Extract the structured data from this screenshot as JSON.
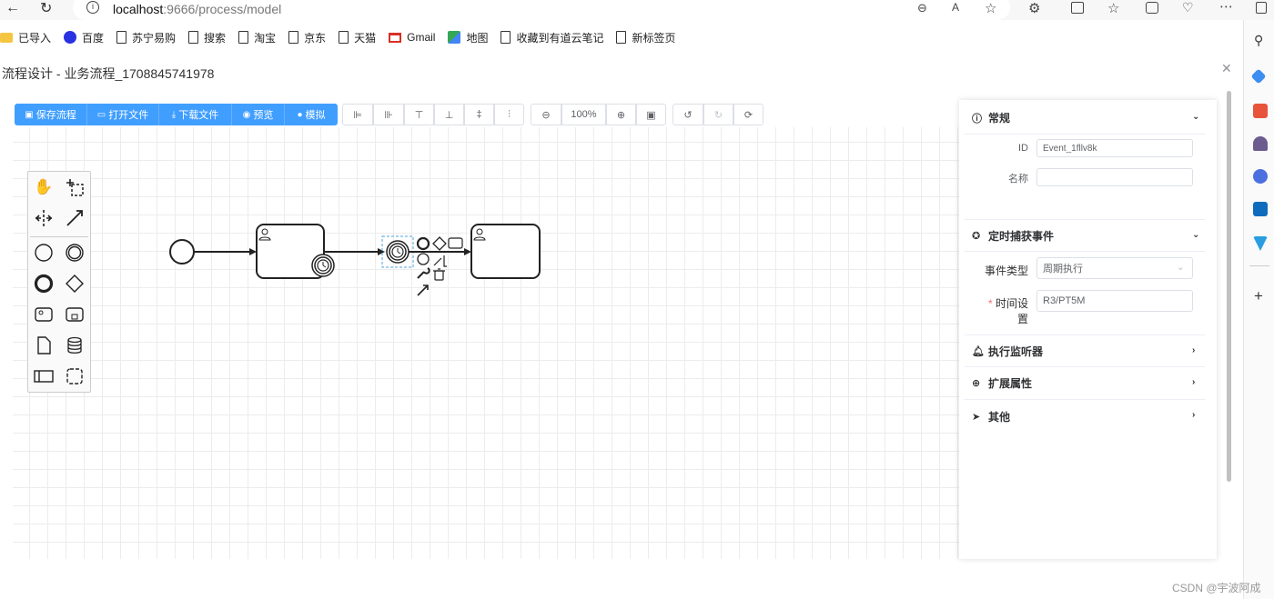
{
  "browser": {
    "url_host": "localhost",
    "url_rest": ":9666/process/model"
  },
  "bookmarks": [
    {
      "label": "已导入",
      "icon": "folder-icon"
    },
    {
      "label": "百度",
      "icon": "baidu-icon"
    },
    {
      "label": "苏宁易购",
      "icon": "page-icon"
    },
    {
      "label": "搜索",
      "icon": "page-icon"
    },
    {
      "label": "淘宝",
      "icon": "page-icon"
    },
    {
      "label": "京东",
      "icon": "page-icon"
    },
    {
      "label": "天猫",
      "icon": "page-icon"
    },
    {
      "label": "Gmail",
      "icon": "gmail-icon"
    },
    {
      "label": "地图",
      "icon": "maps-icon"
    },
    {
      "label": "收藏到有道云笔记",
      "icon": "page-icon"
    },
    {
      "label": "新标签页",
      "icon": "page-icon"
    }
  ],
  "dialog": {
    "title": "流程设计 - 业务流程_1708845741978"
  },
  "toolbar": {
    "save": "保存流程",
    "open": "打开文件",
    "download": "下载文件",
    "preview": "预览",
    "simulate": "模拟",
    "zoom": "100%"
  },
  "props": {
    "general": {
      "title": "常规",
      "id_label": "ID",
      "id_value": "Event_1fllv8k",
      "name_label": "名称",
      "name_value": ""
    },
    "timer": {
      "title": "定时捕获事件",
      "type_label": "事件类型",
      "type_value": "周期执行",
      "time_label": "时间设置",
      "time_value": "R3/PT5M"
    },
    "listener": {
      "title": "执行监听器"
    },
    "extension": {
      "title": "扩展属性"
    },
    "other": {
      "title": "其他"
    }
  },
  "watermark": "CSDN @宇波阿成"
}
